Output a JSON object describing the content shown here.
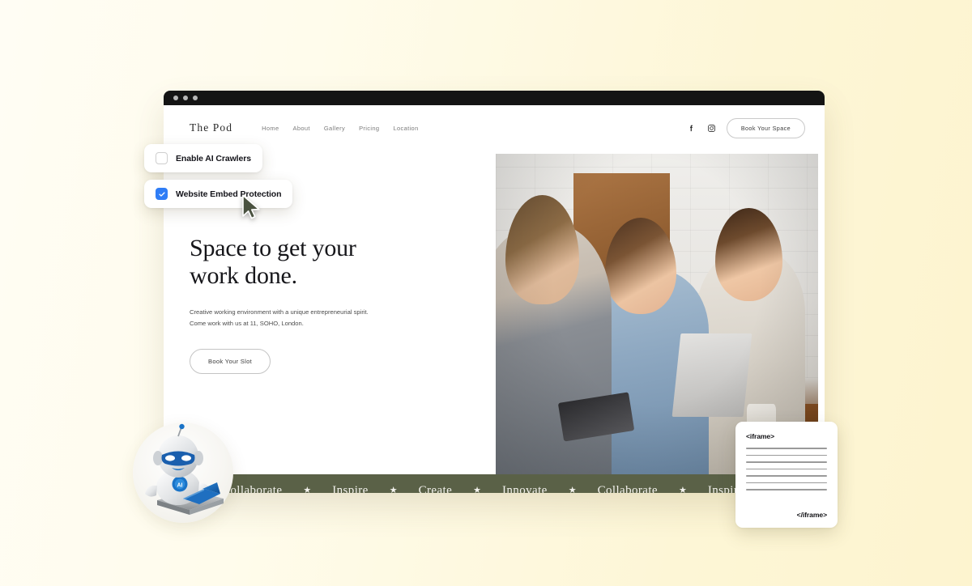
{
  "background": {
    "color_left": "#fffdf4",
    "color_right": "#fdf4cf"
  },
  "browser": {
    "titlebar": {
      "color": "#141414",
      "dots": [
        "window-dot-1",
        "window-dot-2",
        "window-dot-3"
      ]
    }
  },
  "site": {
    "logo": "The Pod",
    "nav_links": [
      {
        "label": "Home"
      },
      {
        "label": "About"
      },
      {
        "label": "Gallery"
      },
      {
        "label": "Pricing"
      },
      {
        "label": "Location"
      }
    ],
    "social": [
      {
        "icon": "facebook-icon",
        "glyph": "f"
      },
      {
        "icon": "instagram-icon",
        "glyph": "▢"
      }
    ],
    "nav_cta": "Book Your Space",
    "hero": {
      "title_line1": "Space to get your",
      "title_line2": "work done.",
      "paragraph_line1": "Creative working environment with a unique entrepreneurial spirit.",
      "paragraph_line2": "Come work with us at 11, SOHO, London.",
      "cta": "Book Your Slot"
    },
    "marquee": {
      "background_color": "#5a6147",
      "text_color": "#f4f3ee",
      "separator": "★",
      "words": [
        "Collaborate",
        "Inspire",
        "Create",
        "Innovate",
        "Collaborate",
        "Inspire"
      ]
    }
  },
  "toggles": [
    {
      "id": "enable-ai-crawlers",
      "label": "Enable AI Crawlers",
      "checked": false
    },
    {
      "id": "website-embed-protection",
      "label": "Website Embed Protection",
      "checked": true,
      "accent_color": "#2f7df6",
      "check_glyph": "✓"
    }
  ],
  "cursor": {
    "name": "mouse-pointer",
    "color": "#4a5240"
  },
  "mascot": {
    "name": "ai-robot-with-laptop",
    "badge_label": "AI",
    "badge_color": "#1a73c7",
    "body_color": "#e2e4e6",
    "laptop_color": "#1464b4"
  },
  "iframe_card": {
    "open_tag": "<iframe>",
    "close_tag": "</iframe>",
    "line_count": 7,
    "line_color": "#9a9a9a"
  }
}
